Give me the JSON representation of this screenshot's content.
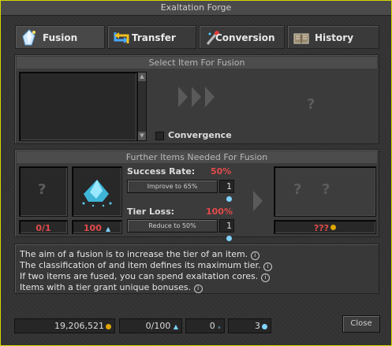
{
  "window": {
    "title": "Exaltation Forge"
  },
  "tabs": [
    {
      "label": "Fusion",
      "icon": "crystal-icon",
      "active": true
    },
    {
      "label": "Transfer",
      "icon": "transfer-arrows-icon",
      "active": false
    },
    {
      "label": "Conversion",
      "icon": "wand-icon",
      "active": false
    },
    {
      "label": "History",
      "icon": "book-icon",
      "active": false
    }
  ],
  "select_panel": {
    "title": "Select Item For Fusion",
    "convergence_label": "Convergence",
    "placeholder_mark": "?"
  },
  "further_panel": {
    "title": "Further Items Needed For Fusion",
    "item1": {
      "mark": "?",
      "count": "0/1"
    },
    "item2": {
      "count": "100",
      "icon": "exaltation-dust-icon"
    },
    "success": {
      "label": "Success Rate:",
      "value": "50%",
      "button": "Improve to 65%",
      "cost": "1",
      "cost_icon": "gem-icon"
    },
    "tierloss": {
      "label": "Tier Loss:",
      "value": "100%",
      "button": "Reduce to 50%",
      "cost": "1",
      "cost_icon": "gem-icon"
    },
    "result": {
      "marks": [
        "?",
        "?"
      ],
      "price": "???"
    }
  },
  "info": {
    "lines": [
      "The aim of a fusion is to increase the tier of an item.",
      "The classification of and item defines its maximum tier.",
      "If two items are fused, you can spend exaltation cores.",
      "Items with a tier grant unique bonuses."
    ]
  },
  "footer": {
    "gold": "19,206,521",
    "dust": "0/100",
    "slivers": "0",
    "cores": "3",
    "close_label": "Close"
  },
  "colors": {
    "accent_red": "#e24a4a",
    "border_yellow": "#d8d800",
    "gold": "#e0a400",
    "gem": "#7fd4ff"
  }
}
